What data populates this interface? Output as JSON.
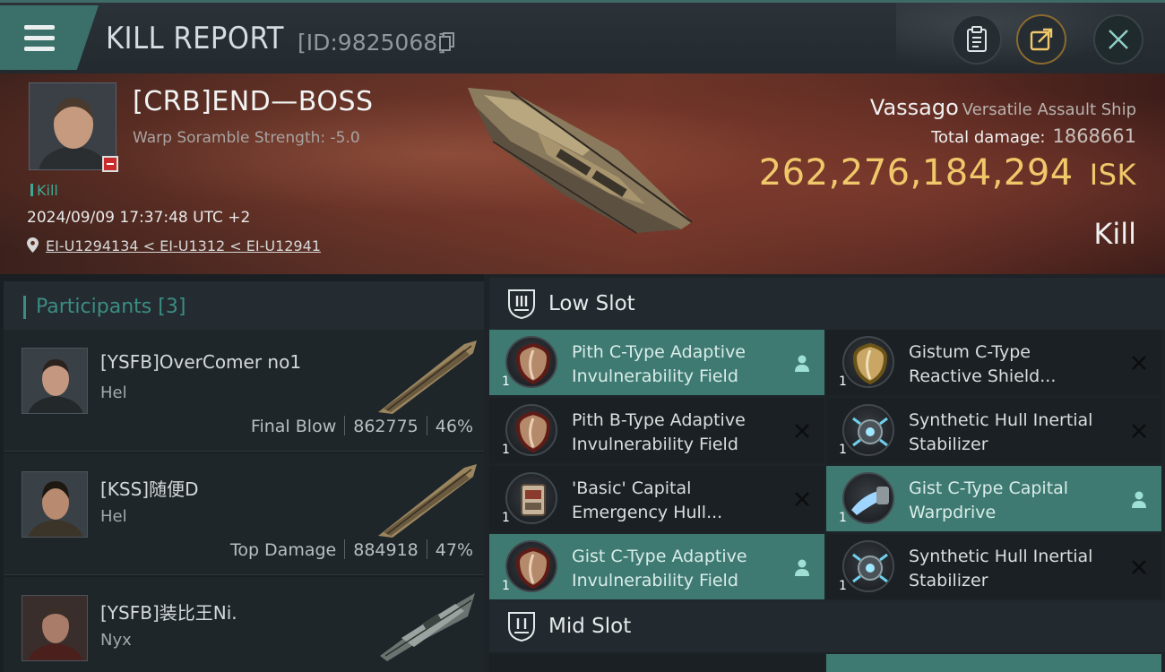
{
  "header": {
    "title": "KILL REPORT",
    "report_id": "[ID:9825068]"
  },
  "victim": {
    "pilot_name": "[CRB]END—BOSS",
    "warp_scramble": "Warp Soramble Strength: -5.0",
    "kill_tag": "Kill",
    "datetime": "2024/09/09 17:37:48 UTC +2",
    "location": "EI-U1294134 < EI-U1312 < EI-U12941",
    "ship_name": "Vassago",
    "ship_class": "Versatile Assault Ship",
    "total_damage_label": "Total damage:",
    "total_damage": "1868661",
    "isk_value": "262,276,184,294",
    "isk_unit": "ISK",
    "result": "Kill"
  },
  "participants": {
    "label": "Participants",
    "count": "[3]",
    "list": [
      {
        "name": "[YSFB]OverComer no1",
        "ship": "Hel",
        "role": "Final Blow",
        "damage": "862775",
        "percent": "46%"
      },
      {
        "name": "[KSS]随便D",
        "ship": "Hel",
        "role": "Top Damage",
        "damage": "884918",
        "percent": "47%"
      },
      {
        "name": "[YSFB]装比王Ni.",
        "ship": "Nyx",
        "role": "",
        "damage": "",
        "percent": ""
      }
    ]
  },
  "slots": {
    "low_label": "Low Slot",
    "mid_label": "Mid Slot",
    "low": [
      {
        "line1": "Pith C-Type Adaptive",
        "line2": "Invulnerability Field",
        "qty": "1",
        "state": "dropped",
        "icon": "shield-module-icon"
      },
      {
        "line1": "Gistum C-Type",
        "line2": "Reactive Shield...",
        "qty": "1",
        "state": "destroyed",
        "icon": "shield-module-icon"
      },
      {
        "line1": "Pith B-Type Adaptive",
        "line2": "Invulnerability Field",
        "qty": "1",
        "state": "destroyed",
        "icon": "shield-module-icon"
      },
      {
        "line1": "Synthetic Hull Inertial",
        "line2": "Stabilizer",
        "qty": "1",
        "state": "destroyed",
        "icon": "stabilizer-module-icon"
      },
      {
        "line1": "'Basic' Capital",
        "line2": "Emergency Hull...",
        "qty": "1",
        "state": "destroyed",
        "icon": "hull-module-icon"
      },
      {
        "line1": "Gist C-Type Capital",
        "line2": "Warpdrive",
        "qty": "1",
        "state": "dropped",
        "icon": "warpdrive-module-icon"
      },
      {
        "line1": "Gist C-Type Adaptive",
        "line2": "Invulnerability Field",
        "qty": "1",
        "state": "dropped",
        "icon": "shield-module-icon"
      },
      {
        "line1": "Synthetic Hull Inertial",
        "line2": "Stabilizer",
        "qty": "1",
        "state": "destroyed",
        "icon": "stabilizer-module-icon"
      }
    ]
  },
  "colors": {
    "accent_teal": "#3a8d83",
    "fitted_bg": "#3f7a72",
    "isk_gold": "#f0c86a",
    "banner_red": "#5a2f26"
  }
}
